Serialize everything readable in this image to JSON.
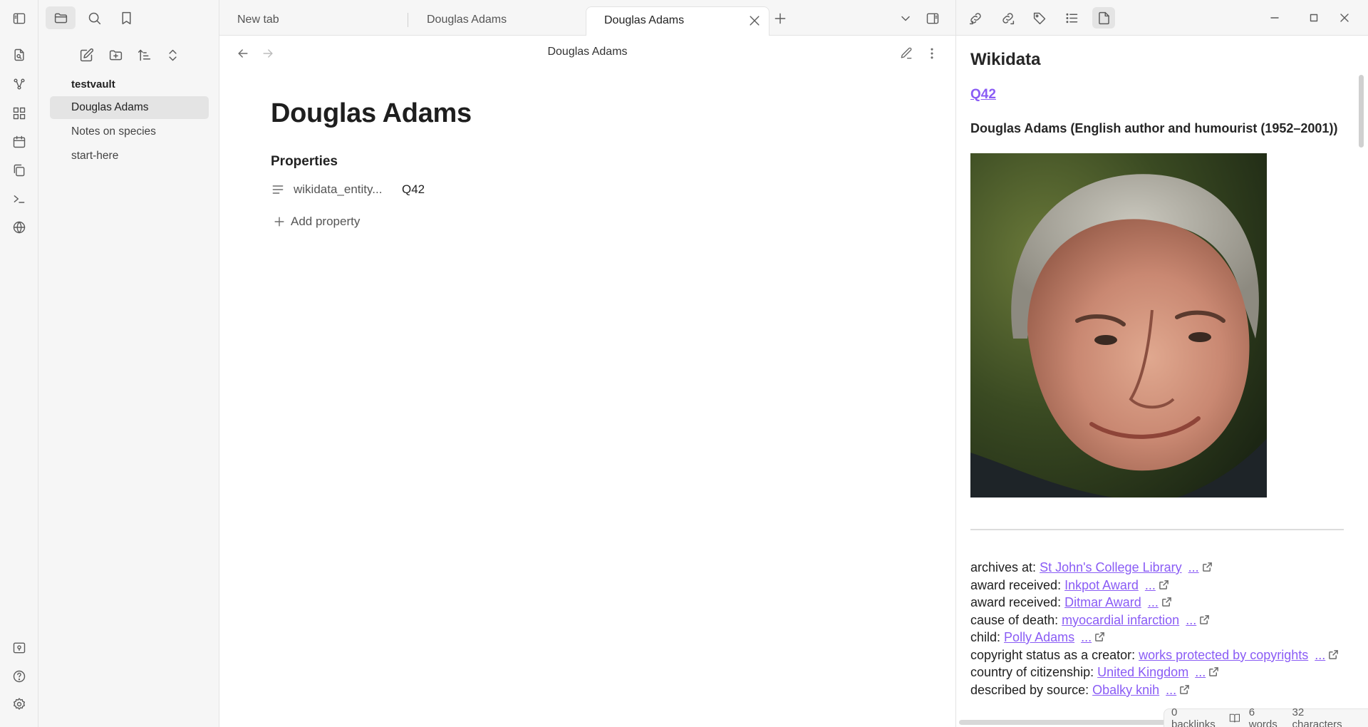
{
  "sidebar": {
    "vault_name": "testvault",
    "files": [
      {
        "label": "Douglas Adams",
        "active": true
      },
      {
        "label": "Notes on species",
        "active": false
      },
      {
        "label": "start-here",
        "active": false
      }
    ]
  },
  "tabs": [
    {
      "label": "New tab"
    },
    {
      "label": "Douglas Adams"
    },
    {
      "label": "Douglas Adams"
    }
  ],
  "main": {
    "view_title": "Douglas Adams",
    "note_title": "Douglas Adams",
    "properties_heading": "Properties",
    "property": {
      "key": "wikidata_entity...",
      "value": "Q42"
    },
    "add_property_label": "Add property"
  },
  "wikidata": {
    "title": "Wikidata",
    "entity_id": "Q42",
    "description": "Douglas Adams (English author and humourist (1952–2001))",
    "claims": [
      {
        "label": "archives at:",
        "value": "St John's College Library",
        "ext": "..."
      },
      {
        "label": "award received:",
        "value": "Inkpot Award",
        "ext": "..."
      },
      {
        "label": "award received:",
        "value": "Ditmar Award",
        "ext": "..."
      },
      {
        "label": "cause of death:",
        "value": "myocardial infarction",
        "ext": "..."
      },
      {
        "label": "child:",
        "value": "Polly Adams",
        "ext": "..."
      },
      {
        "label": "copyright status as a creator:",
        "value": "works protected by copyrights",
        "ext": "..."
      },
      {
        "label": "country of citizenship:",
        "value": "United Kingdom",
        "ext": "..."
      },
      {
        "label": "described by source:",
        "value": "Obalky knih",
        "ext": "..."
      }
    ]
  },
  "status_bar": {
    "backlinks": "0 backlinks",
    "words": "6 words",
    "characters": "32 characters"
  },
  "colors": {
    "accent": "#8a5cf5",
    "sidebar_bg": "#f6f6f6",
    "active_item_bg": "#e4e4e4"
  }
}
